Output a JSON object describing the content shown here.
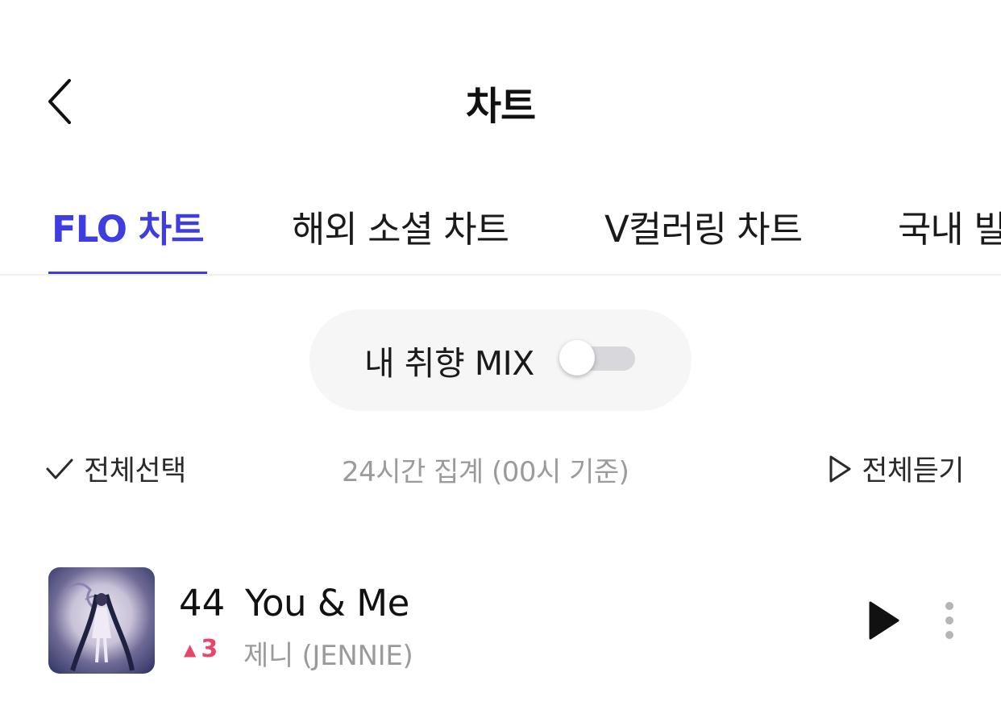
{
  "header": {
    "title": "차트",
    "back_icon": "chevron-left-icon"
  },
  "tabs": [
    {
      "label": "FLO 차트",
      "active": true
    },
    {
      "label": "해외 소셜 차트",
      "active": false
    },
    {
      "label": "V컬러링 차트",
      "active": false
    },
    {
      "label": "국내 빌",
      "active": false
    }
  ],
  "mix": {
    "label": "내 취향 MIX",
    "enabled": false
  },
  "controls": {
    "select_all_label": "전체선택",
    "aggregation_text": "24시간 집계 (00시 기준)",
    "play_all_label": "전체듣기"
  },
  "tracks": [
    {
      "rank": "44",
      "title": "You & Me",
      "rank_change": "3",
      "rank_direction": "up",
      "artist": "제니 (JENNIE)"
    }
  ],
  "colors": {
    "accent": "#3d3de0",
    "rank_up": "#e8456a",
    "muted_text": "#9b9b9b"
  }
}
